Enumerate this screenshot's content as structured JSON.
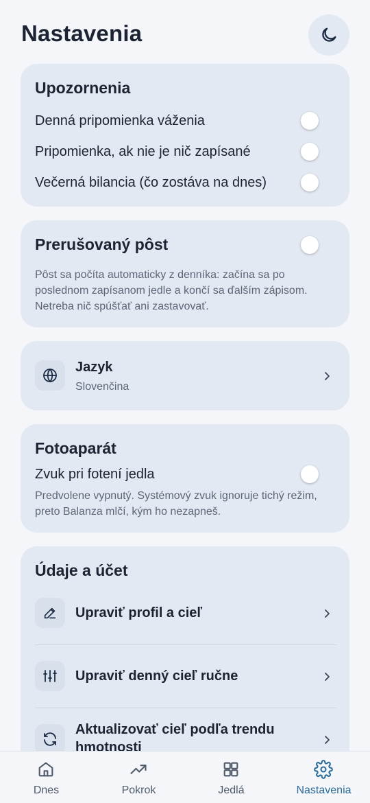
{
  "header": {
    "title": "Nastavenia",
    "theme_icon": "moon-icon"
  },
  "notifications": {
    "title": "Upozornenia",
    "items": [
      {
        "label": "Denná pripomienka váženia",
        "enabled": false
      },
      {
        "label": "Pripomienka, ak nie je nič zapísané",
        "enabled": false
      },
      {
        "label": "Večerná bilancia (čo zostáva na dnes)",
        "enabled": false
      }
    ]
  },
  "fasting": {
    "title": "Prerušovaný pôst",
    "enabled": false,
    "description": "Pôst sa počíta automaticky z denníka: začína sa po poslednom zapísanom jedle a končí sa ďalším zápisom. Netreba nič spúšťať ani zastavovať."
  },
  "language": {
    "title": "Jazyk",
    "value": "Slovenčina",
    "icon": "globe-icon"
  },
  "camera": {
    "title": "Fotoaparát",
    "toggle_label": "Zvuk pri fotení jedla",
    "enabled": false,
    "description": "Predvolene vypnutý. Systémový zvuk ignoruje tichý režim, preto Balanza mlčí, kým ho nezapneš."
  },
  "account": {
    "title": "Údaje a účet",
    "items": [
      {
        "label": "Upraviť profil a cieľ",
        "icon": "pencil-icon"
      },
      {
        "label": "Upraviť denný cieľ ručne",
        "icon": "sliders-icon"
      },
      {
        "label": "Aktualizovať cieľ podľa trendu hmotnosti",
        "icon": "refresh-icon"
      }
    ]
  },
  "tabbar": {
    "active": "Nastavenia",
    "tabs": [
      {
        "label": "Dnes",
        "icon": "home-icon"
      },
      {
        "label": "Pokrok",
        "icon": "trend-up-icon"
      },
      {
        "label": "Jedlá",
        "icon": "grid-icon"
      },
      {
        "label": "Nastavenia",
        "icon": "gear-icon"
      }
    ]
  },
  "colors": {
    "accent": "#2c6c97",
    "card": "#e3e9f2",
    "background": "#f4f6fa",
    "text": "#1c2433"
  }
}
